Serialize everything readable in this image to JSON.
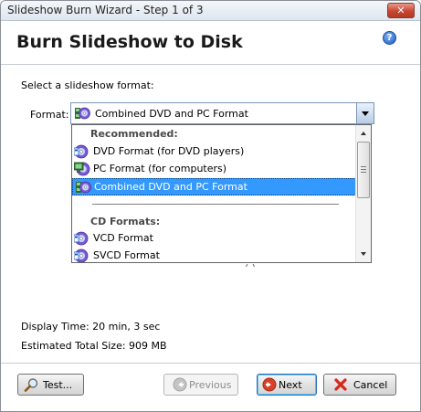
{
  "window": {
    "title": "Slideshow Burn Wizard - Step 1 of 3",
    "close_glyph": "✕"
  },
  "heading": "Burn Slideshow to Disk",
  "help_glyph": "?",
  "prompt": "Select a slideshow format:",
  "format": {
    "label": "Format:",
    "selected": "Combined DVD and PC Format",
    "groups": [
      {
        "header": "Recommended:",
        "items": [
          "DVD Format (for DVD players)",
          "PC Format (for computers)",
          "Combined DVD and PC Format"
        ]
      },
      {
        "header": "CD Formats:",
        "items": [
          "VCD Format",
          "SVCD Format"
        ]
      }
    ],
    "selected_index": 2
  },
  "obscured_text_fragment": "(                  )",
  "info": {
    "display_time": "Display Time: 20 min, 3 sec",
    "total_size": "Estimated Total Size: 909 MB"
  },
  "buttons": {
    "test": "Test...",
    "previous": "Previous",
    "next": "Next",
    "cancel": "Cancel"
  },
  "icons": {
    "help": "help-icon",
    "disc": "disc-icon",
    "search": "magnifier-icon",
    "previous": "back-arrow-icon",
    "next": "forward-arrow-icon",
    "cancel": "red-x-icon"
  }
}
